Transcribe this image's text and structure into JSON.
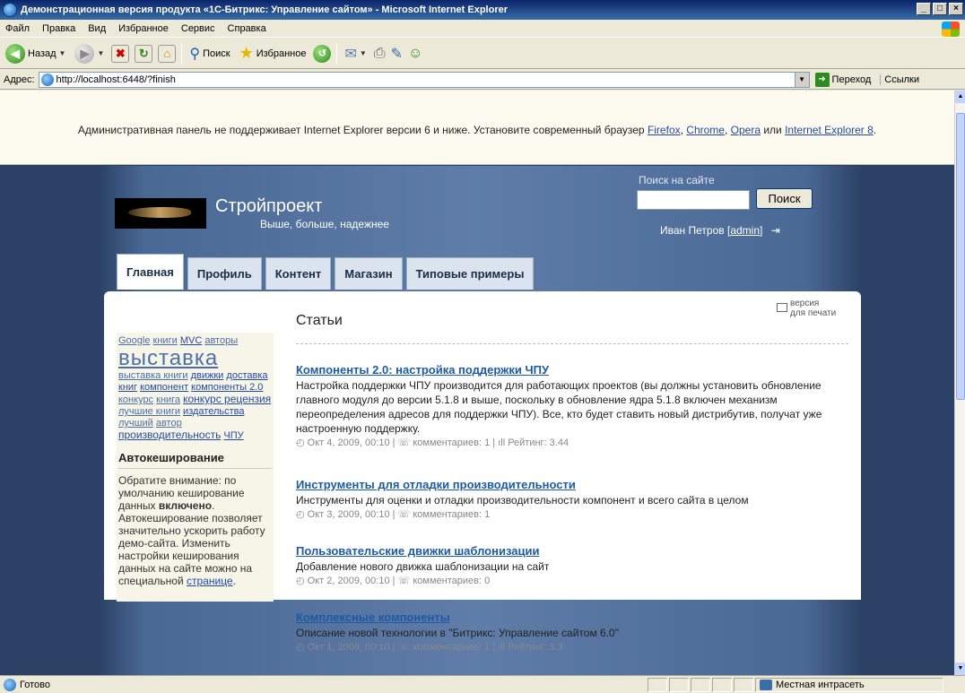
{
  "window": {
    "title": "Демонстрационная версия продукта «1С-Битрикс: Управление сайтом» - Microsoft Internet Explorer",
    "minimize": "_",
    "maximize": "□",
    "close": "×"
  },
  "menu": [
    "Файл",
    "Правка",
    "Вид",
    "Избранное",
    "Сервис",
    "Справка"
  ],
  "toolbar": {
    "back": "Назад",
    "search": "Поиск",
    "favorites": "Избранное"
  },
  "address": {
    "label": "Адрес:",
    "url": "http://localhost:6448/?finish",
    "go": "Переход",
    "links": "Ссылки"
  },
  "warning": {
    "text_before": "Административная панель не поддерживает Internet Explorer версии 6 и ниже. Установите современный браузер ",
    "firefox": "Firefox",
    "comma1": ", ",
    "chrome": "Chrome",
    "comma2": ", ",
    "opera": "Opera",
    "or": " или ",
    "ie8": "Internet Explorer 8",
    "end": "."
  },
  "site": {
    "name": "Стройпроект",
    "slogan": "Выше, больше, надежнее",
    "search_label": "Поиск на сайте",
    "search_button": "Поиск",
    "user_name": "Иван Петров",
    "user_login": "admin"
  },
  "tabs": [
    "Главная",
    "Профиль",
    "Контент",
    "Магазин",
    "Типовые примеры"
  ],
  "tags": [
    {
      "t": "Google",
      "c": ""
    },
    {
      "t": "книги",
      "c": ""
    },
    {
      "t": "MVC",
      "c": "dark"
    },
    {
      "t": "авторы",
      "c": ""
    },
    {
      "t": "выставка",
      "c": "big"
    },
    {
      "t": "выставка книги",
      "c": ""
    },
    {
      "t": "движки",
      "c": "dark"
    },
    {
      "t": "доставка книг",
      "c": "dark"
    },
    {
      "t": "компонент",
      "c": "dark"
    },
    {
      "t": "компоненты 2.0",
      "c": "dark"
    },
    {
      "t": "конкурс",
      "c": ""
    },
    {
      "t": "книга",
      "c": ""
    },
    {
      "t": "конкурс рецензия",
      "c": "dark mid"
    },
    {
      "t": "лучшие книги",
      "c": ""
    },
    {
      "t": "издательства",
      "c": "dark"
    },
    {
      "t": "лучший",
      "c": ""
    },
    {
      "t": "автор",
      "c": ""
    },
    {
      "t": "производительность",
      "c": "dark mid"
    },
    {
      "t": "ЧПУ",
      "c": "dark"
    }
  ],
  "cache": {
    "title": "Автокеширование",
    "text1": "Обратите внимание: по умолчанию кеширование данных ",
    "bold": "включено",
    "text2": ". Автокеширование позволяет значительно ускорить работу демо-сайта. Изменить настройки кеширования данных на сайте можно на специальной ",
    "link": "странице",
    "text3": "."
  },
  "main": {
    "section_title": "Статьи",
    "print_line1": "версия",
    "print_line2": "для печати"
  },
  "articles": [
    {
      "title": "Компоненты 2.0: настройка поддержки ЧПУ",
      "desc": "Настройка поддержки ЧПУ производится для работающих проектов (вы должны установить обновление главного модуля до версии 5.1.8 и выше, поскольку в обновление ядра 5.1.8 включен механизм переопределения адресов для поддержки ЧПУ). Все, кто будет ставить новый дистрибутив, получат уже настроенную поддержку.",
      "meta": "◴ Окт 4, 2009, 00:10 | ☏ комментариев: 1 | ıll Рейтинг: 3.44"
    },
    {
      "title": "Инструменты для отладки производительности",
      "desc": "Инструменты для оценки и отладки производительности компонент и всего сайта в целом",
      "meta": "◴ Окт 3, 2009, 00:10 | ☏ комментариев: 1"
    },
    {
      "title": "Пользовательские движки шаблонизации",
      "desc": "Добавление нового движка шаблонизации на сайт",
      "meta": "◴ Окт 2, 2009, 00:10 | ☏ комментариев: 0"
    },
    {
      "title": "Комплексные компоненты",
      "desc": "Описание новой технологии в \"Битрикс: Управление сайтом 6.0\"",
      "meta": "◴ Окт 1, 2009, 00:10 | ☏ комментариев: 1 | ıll Рейтинг: 3.3"
    }
  ],
  "status": {
    "text": "Готово",
    "zone": "Местная интрасеть"
  }
}
